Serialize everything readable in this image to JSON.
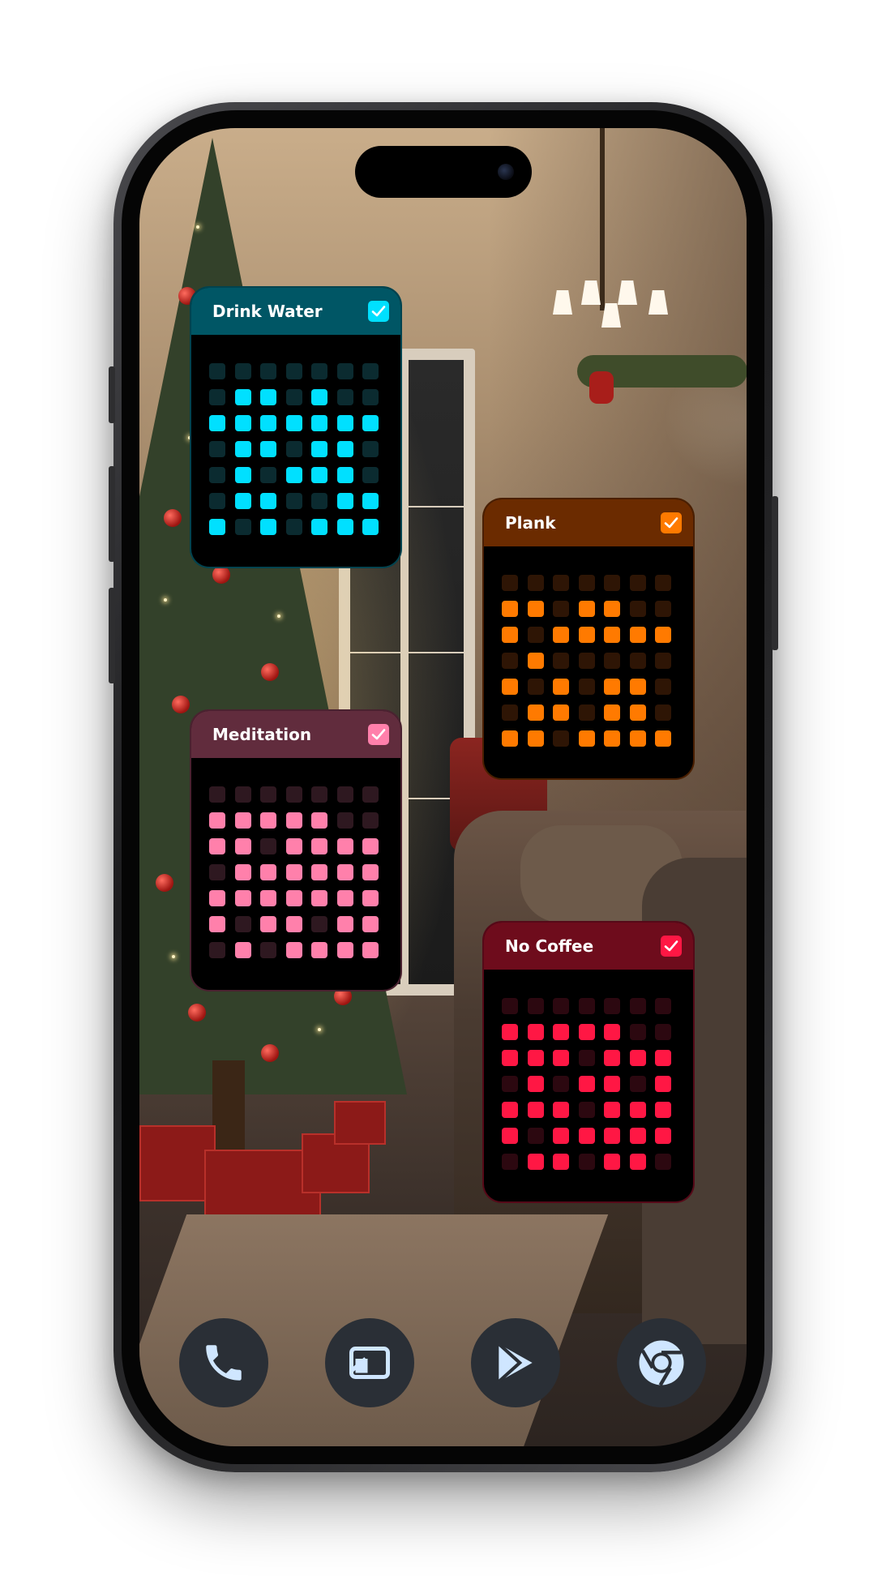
{
  "habits": [
    {
      "title": "Drink Water",
      "checked": true,
      "header_color": "#005665",
      "active_color": "#00e0ff",
      "inactive_color": "#0b2b30",
      "border_color": "#00434f",
      "grid": [
        [
          0,
          0,
          0,
          0,
          0,
          0,
          0
        ],
        [
          0,
          1,
          1,
          0,
          1,
          0,
          0
        ],
        [
          1,
          1,
          1,
          1,
          1,
          1,
          1
        ],
        [
          0,
          1,
          1,
          0,
          1,
          1,
          0
        ],
        [
          0,
          1,
          0,
          1,
          1,
          1,
          0
        ],
        [
          0,
          1,
          1,
          0,
          0,
          1,
          1
        ],
        [
          1,
          0,
          1,
          0,
          1,
          1,
          1
        ]
      ]
    },
    {
      "title": "Plank",
      "checked": true,
      "header_color": "#6b2b00",
      "active_color": "#ff7a00",
      "inactive_color": "#2e1505",
      "border_color": "#4a1f00",
      "grid": [
        [
          0,
          0,
          0,
          0,
          0,
          0,
          0
        ],
        [
          1,
          1,
          0,
          1,
          1,
          0,
          0
        ],
        [
          1,
          0,
          1,
          1,
          1,
          1,
          1
        ],
        [
          0,
          1,
          0,
          0,
          0,
          0,
          0
        ],
        [
          1,
          0,
          1,
          0,
          1,
          1,
          0
        ],
        [
          0,
          1,
          1,
          0,
          1,
          1,
          0
        ],
        [
          1,
          1,
          0,
          1,
          1,
          1,
          1
        ]
      ]
    },
    {
      "title": "Meditation",
      "checked": true,
      "header_color": "#612c3d",
      "active_color": "#ff80ab",
      "inactive_color": "#2e1820",
      "border_color": "#4a2230",
      "grid": [
        [
          0,
          0,
          0,
          0,
          0,
          0,
          0
        ],
        [
          1,
          1,
          1,
          1,
          1,
          0,
          0
        ],
        [
          1,
          1,
          0,
          1,
          1,
          1,
          1
        ],
        [
          0,
          1,
          1,
          1,
          1,
          1,
          1
        ],
        [
          1,
          1,
          1,
          1,
          1,
          1,
          1
        ],
        [
          1,
          0,
          1,
          1,
          0,
          1,
          1
        ],
        [
          0,
          1,
          0,
          1,
          1,
          1,
          1
        ]
      ]
    },
    {
      "title": "No Coffee",
      "checked": true,
      "header_color": "#6e0c1c",
      "active_color": "#ff1744",
      "inactive_color": "#2c0810",
      "border_color": "#560918",
      "grid": [
        [
          0,
          0,
          0,
          0,
          0,
          0,
          0
        ],
        [
          1,
          1,
          1,
          1,
          1,
          0,
          0
        ],
        [
          1,
          1,
          1,
          0,
          1,
          1,
          1
        ],
        [
          0,
          1,
          0,
          1,
          1,
          0,
          1
        ],
        [
          1,
          1,
          1,
          0,
          1,
          1,
          1
        ],
        [
          1,
          0,
          1,
          1,
          1,
          1,
          1
        ],
        [
          0,
          1,
          1,
          0,
          1,
          1,
          0
        ]
      ]
    }
  ],
  "dock": [
    {
      "icon": "phone-icon"
    },
    {
      "icon": "gallery-icon"
    },
    {
      "icon": "play-store-icon"
    },
    {
      "icon": "chrome-icon"
    }
  ]
}
